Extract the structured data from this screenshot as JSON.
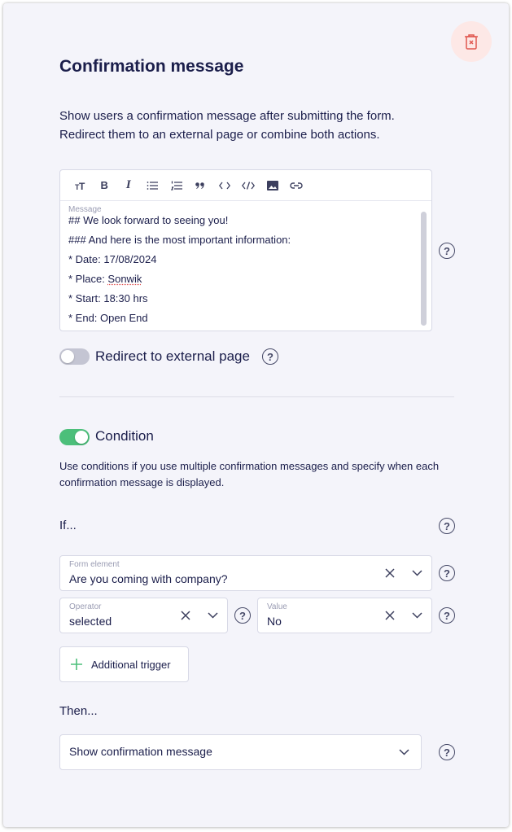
{
  "header": {
    "title": "Confirmation message",
    "description": "Show users a confirmation message after submitting the form. Redirect them to an external page or combine both actions."
  },
  "toolbar": {
    "items": [
      "text-size-icon",
      "bold-icon",
      "italic-icon",
      "bullet-list-icon",
      "numbered-list-icon",
      "quote-icon",
      "code-icon",
      "code-block-icon",
      "image-icon",
      "link-icon"
    ],
    "bold_glyph": "B",
    "italic_glyph": "I"
  },
  "editor": {
    "label": "Message",
    "lines": [
      "## We look forward to seeing you!",
      "### And here is the most important information:",
      "* Date: 17/08/2024",
      "* Place: ",
      "* Start: 18:30 hrs",
      "* End: Open End"
    ],
    "place_value": "Sonwik"
  },
  "redirect": {
    "label": "Redirect to external page",
    "enabled": false
  },
  "condition": {
    "label": "Condition",
    "enabled": true,
    "description": "Use conditions if you use multiple confirmation messages and specify when each confirmation message is displayed."
  },
  "if_section": {
    "label": "If...",
    "form_element": {
      "label": "Form element",
      "value": "Are you coming with company?"
    },
    "operator": {
      "label": "Operator",
      "value": "selected"
    },
    "value": {
      "label": "Value",
      "value": "No"
    },
    "add_trigger_label": "Additional trigger"
  },
  "then_section": {
    "label": "Then...",
    "action": {
      "value": "Show confirmation message"
    }
  },
  "help_glyph": "?",
  "colors": {
    "accent_green": "#4cbf7a",
    "delete_bg": "#fde8e6",
    "delete_icon": "#e0574f",
    "text": "#1b1e4b"
  }
}
